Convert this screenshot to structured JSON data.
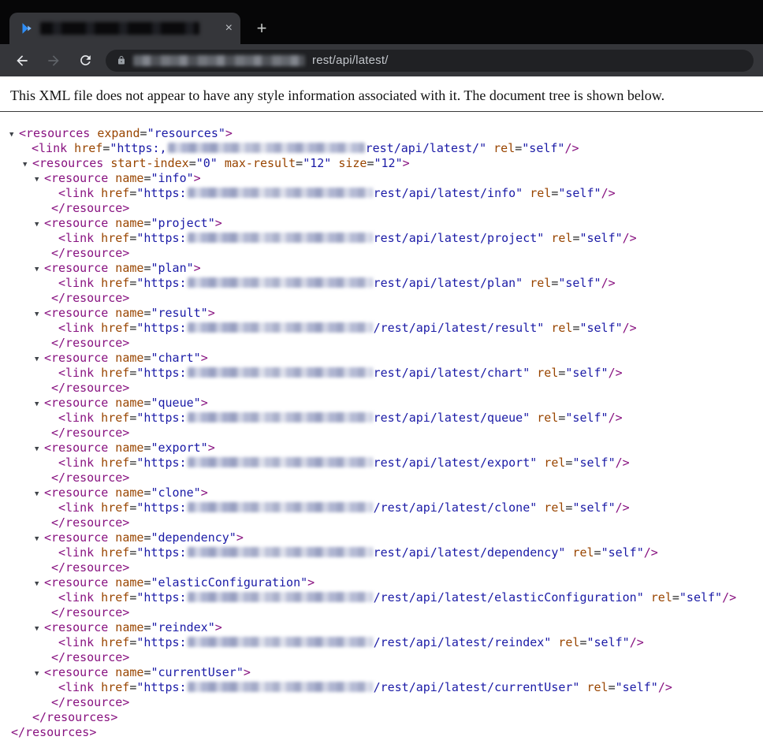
{
  "browser": {
    "tab": {
      "close_label": "×",
      "new_tab_label": "+",
      "title_redacted": true
    },
    "nav": {
      "url_suffix": "rest/api/latest/"
    }
  },
  "page": {
    "notice": "This XML file does not appear to have any style information associated with it. The document tree is shown below.",
    "colors": {
      "tag": "#881280",
      "attr_name": "#994500",
      "attr_value": "#1a1aa6",
      "toolbar": "#35363a",
      "omnibox": "#202124"
    }
  },
  "xml": {
    "toggle_glyph": "▼",
    "rel_value": "self",
    "link_prefix": "https:",
    "root": {
      "tag": "resources",
      "attrs": [
        {
          "name": "expand",
          "value": "resources"
        }
      ]
    },
    "root_link": {
      "href_prefix": "https:,",
      "href_visible": "rest/api/latest/"
    },
    "inner": {
      "tag": "resources",
      "attrs": [
        {
          "name": "start-index",
          "value": "0"
        },
        {
          "name": "max-result",
          "value": "12"
        },
        {
          "name": "size",
          "value": "12"
        }
      ]
    },
    "resources": [
      {
        "name": "info",
        "path": "rest/api/latest/info"
      },
      {
        "name": "project",
        "path": "rest/api/latest/project"
      },
      {
        "name": "plan",
        "path": "rest/api/latest/plan"
      },
      {
        "name": "result",
        "path": "/rest/api/latest/result"
      },
      {
        "name": "chart",
        "path": "rest/api/latest/chart"
      },
      {
        "name": "queue",
        "path": "rest/api/latest/queue"
      },
      {
        "name": "export",
        "path": "rest/api/latest/export"
      },
      {
        "name": "clone",
        "path": "/rest/api/latest/clone"
      },
      {
        "name": "dependency",
        "path": "rest/api/latest/dependency"
      },
      {
        "name": "elasticConfiguration",
        "path": "/rest/api/latest/elasticConfiguration"
      },
      {
        "name": "reindex",
        "path": "/rest/api/latest/reindex"
      },
      {
        "name": "currentUser",
        "path": "/rest/api/latest/currentUser"
      }
    ]
  }
}
